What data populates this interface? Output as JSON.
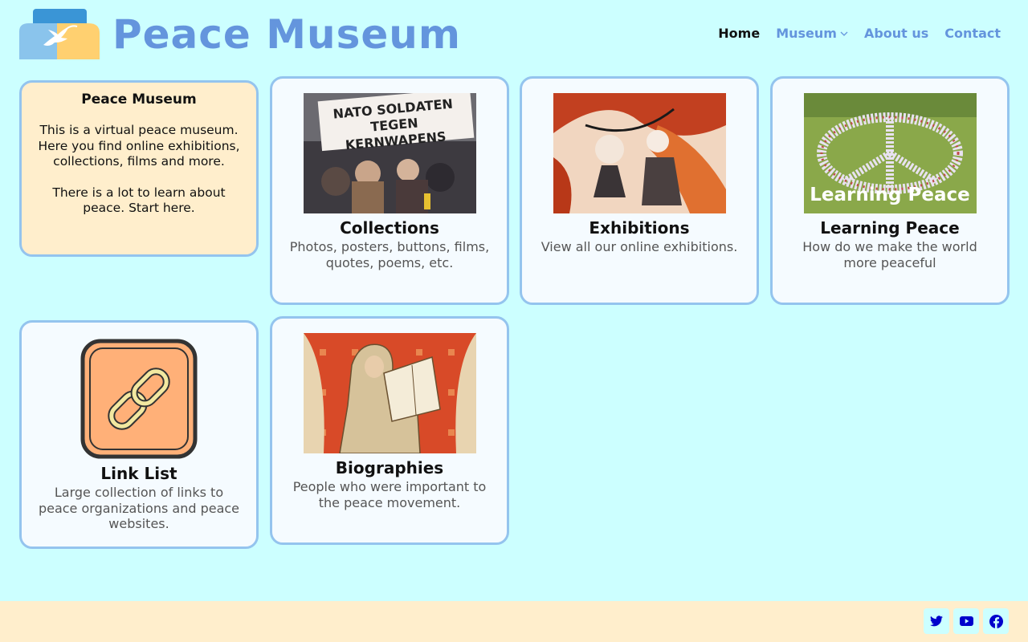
{
  "site": {
    "title": "Peace Museum"
  },
  "nav": {
    "home": "Home",
    "museum": "Museum",
    "about": "About us",
    "contact": "Contact"
  },
  "intro": {
    "title": "Peace Museum",
    "text1": "This is a virtual peace museum. Here you find online exhibitions, collections, films and more.",
    "text2": "There is a lot to learn about peace. Start here."
  },
  "cards": [
    {
      "title": "Collections",
      "desc": "Photos, posters, buttons, films, quotes, poems, etc.",
      "banner": "NATO SOLDATEN TEGEN KERNWAPENS"
    },
    {
      "title": "Exhibitions",
      "desc": "View all our online exhibitions."
    },
    {
      "title": "Learning Peace",
      "desc": "How do we make the world more peaceful",
      "overlay": "Learning Peace"
    },
    {
      "title": "Link List",
      "desc": "Large collection of links to peace organizations and peace websites."
    },
    {
      "title": "Biographies",
      "desc": "People who were important to the peace movement."
    }
  ],
  "footer": {
    "icons": [
      "twitter-icon",
      "youtube-icon",
      "facebook-icon"
    ]
  },
  "colors": {
    "background": "#ccffff",
    "accent": "#6495dd",
    "card_border": "#94c4ee",
    "intro_bg": "#ffeecc",
    "footer_bg": "#ffeecc",
    "social_icon": "#0000cc"
  }
}
